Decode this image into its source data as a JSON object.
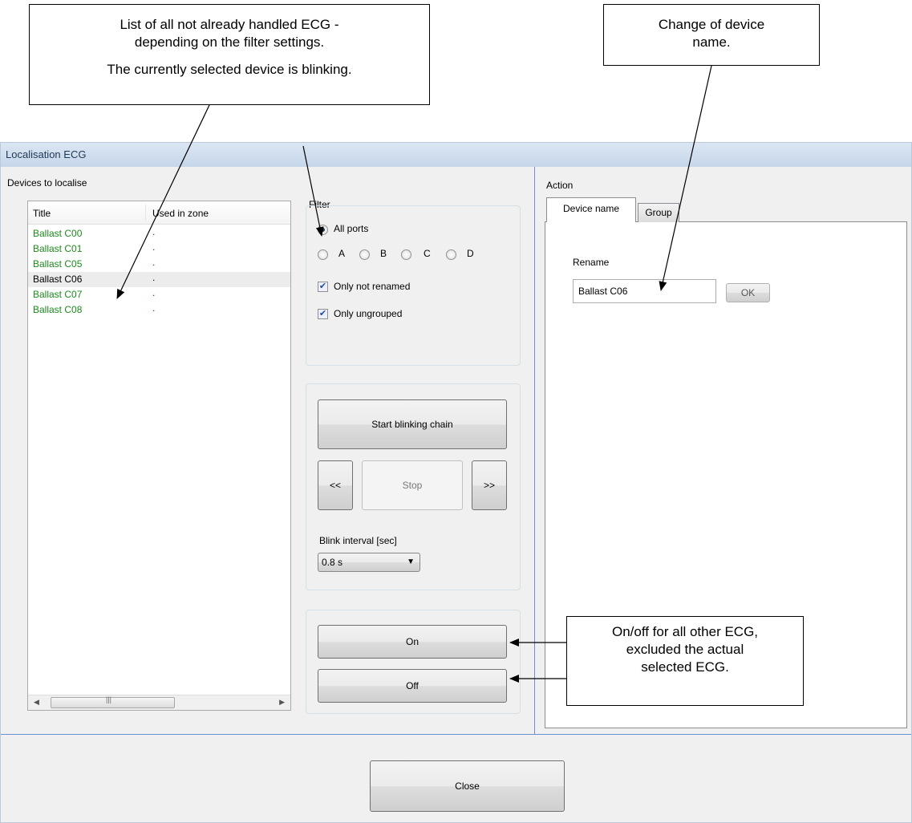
{
  "callouts": {
    "list": {
      "line1": "List of all not already handled ECG -",
      "line2": "depending on the filter settings.",
      "line3": "The currently selected device is blinking."
    },
    "rename": {
      "line1": "Change of device",
      "line2": "name."
    },
    "onoff": {
      "line1": "On/off for all other ECG,",
      "line2": "excluded the actual",
      "line3": "selected ECG."
    }
  },
  "window": {
    "title": "Localisation ECG"
  },
  "devices": {
    "label": "Devices to localise",
    "columns": [
      "Title",
      "Used in zone"
    ],
    "rows": [
      {
        "title": "Ballast C00",
        "zone": ".",
        "color": "#1e8a1e",
        "selected": false
      },
      {
        "title": "Ballast C01",
        "zone": ".",
        "color": "#1e8a1e",
        "selected": false
      },
      {
        "title": "Ballast C05",
        "zone": ".",
        "color": "#1e8a1e",
        "selected": false
      },
      {
        "title": "Ballast C06",
        "zone": ".",
        "color": "#000000",
        "selected": true
      },
      {
        "title": "Ballast C07",
        "zone": ".",
        "color": "#1e8a1e",
        "selected": false
      },
      {
        "title": "Ballast C08",
        "zone": ".",
        "color": "#1e8a1e",
        "selected": false
      }
    ]
  },
  "filter": {
    "label": "Filter",
    "all_ports": "All ports",
    "ports": [
      "A",
      "B",
      "C",
      "D"
    ],
    "only_not_renamed": "Only not renamed",
    "only_ungrouped": "Only ungrouped"
  },
  "blink": {
    "start": "Start blinking chain",
    "prev": "<<",
    "stop": "Stop",
    "next": ">>",
    "interval_label": "Blink interval [sec]",
    "interval_value": "0.8 s"
  },
  "power": {
    "on": "On",
    "off": "Off"
  },
  "action": {
    "label": "Action",
    "tabs": [
      "Device name",
      "Group"
    ],
    "rename_label": "Rename",
    "rename_value": "Ballast C06",
    "ok": "OK"
  },
  "footer": {
    "close": "Close"
  },
  "colors": {
    "accent": "#6d8fd6",
    "active_device": "#1e8a1e",
    "zone_dot": "#cc0000"
  }
}
